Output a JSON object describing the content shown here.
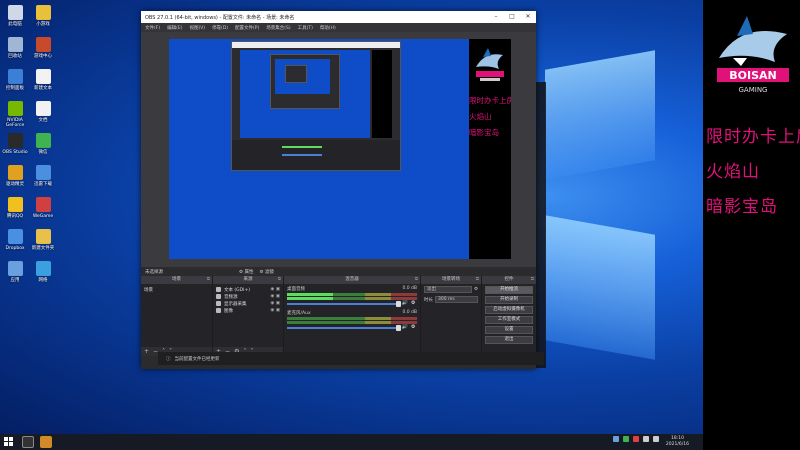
{
  "desktop": {
    "icons": [
      {
        "label": "此电脑",
        "color": "#cfd8e6"
      },
      {
        "label": "小游戏",
        "color": "#e8c03a"
      },
      {
        "label": "回收站",
        "color": "#9fb7d4"
      },
      {
        "label": "游戏中心",
        "color": "#c74b2a"
      },
      {
        "label": "控制面板",
        "color": "#3b7fd6"
      },
      {
        "label": "新建文本",
        "color": "#f2f2f2"
      },
      {
        "label": "NVIDIA GeForce",
        "color": "#76b900"
      },
      {
        "label": "文档",
        "color": "#f2f2f2"
      },
      {
        "label": "OBS Studio",
        "color": "#2a2a2a"
      },
      {
        "label": "微信",
        "color": "#3fb34f"
      },
      {
        "label": "驱动精灵",
        "color": "#e0a020"
      },
      {
        "label": "迅雷下载",
        "color": "#4a8fe0"
      },
      {
        "label": "腾讯QQ",
        "color": "#f0c020"
      },
      {
        "label": "WeGame",
        "color": "#d04040"
      },
      {
        "label": "Dropbox",
        "color": "#4a90e2"
      },
      {
        "label": "新建文件夹",
        "color": "#e8c04a"
      },
      {
        "label": "应用",
        "color": "#6aa0e0"
      },
      {
        "label": "网络",
        "color": "#3aa0e0"
      }
    ]
  },
  "sidepanel": {
    "logo_text": "BOISAN",
    "logo_sub": "GAMING",
    "lines": [
      "限时办卡上房管",
      "火焰山",
      "暗影宝岛"
    ]
  },
  "taskbar": {
    "clock_time": "18:10",
    "clock_date": "2021/6/16"
  },
  "obs": {
    "title": "OBS 27.0.1 (64-bit, windows) - 配置文件: 未命名 - 场景: 未命名",
    "menu": [
      "文件(F)",
      "编辑(E)",
      "视图(V)",
      "停靠(D)",
      "配置文件(P)",
      "场景集合(S)",
      "工具(T)",
      "帮助(H)"
    ],
    "dock_label": "未选择源",
    "dock_props": "属性",
    "dock_filters": "滤镜",
    "panels": {
      "scenes": {
        "title": "场景",
        "items": [
          "场景"
        ]
      },
      "sources": {
        "title": "来源",
        "items": [
          {
            "icon": "text-icon",
            "label": "文本 (GDI+)"
          },
          {
            "icon": "audio-icon",
            "label": "音频源"
          },
          {
            "icon": "display-icon",
            "label": "显示器采集"
          },
          {
            "icon": "image-icon",
            "label": "图像"
          }
        ]
      },
      "mixer": {
        "title": "混音器",
        "channels": [
          {
            "name": "桌面音频",
            "db": "0.0 dB",
            "level": 0.35
          },
          {
            "name": "麦克风/Aux",
            "db": "0.0 dB",
            "level": 0.0
          }
        ]
      },
      "transitions": {
        "title": "场景转场",
        "type": "淡出",
        "duration_label": "时长",
        "duration": "300 ms"
      },
      "controls": {
        "title": "控件",
        "buttons": [
          "开始推流",
          "开始录制",
          "启动虚拟摄像机",
          "工作室模式",
          "设置",
          "退出"
        ]
      }
    },
    "status": {
      "live": "LIVE: 00:00:00",
      "rec": "REC: 00:00:00",
      "cpu": "CPU: 0.5%, 60.00 fps"
    },
    "notification": "当前配置文件已经更新"
  },
  "canvas_text": [
    "限时办卡上房管",
    "火焰山",
    "暗影宝岛"
  ],
  "colors": {
    "accent_pink": "#e0127a",
    "obs_bg": "#2b2b2e"
  }
}
